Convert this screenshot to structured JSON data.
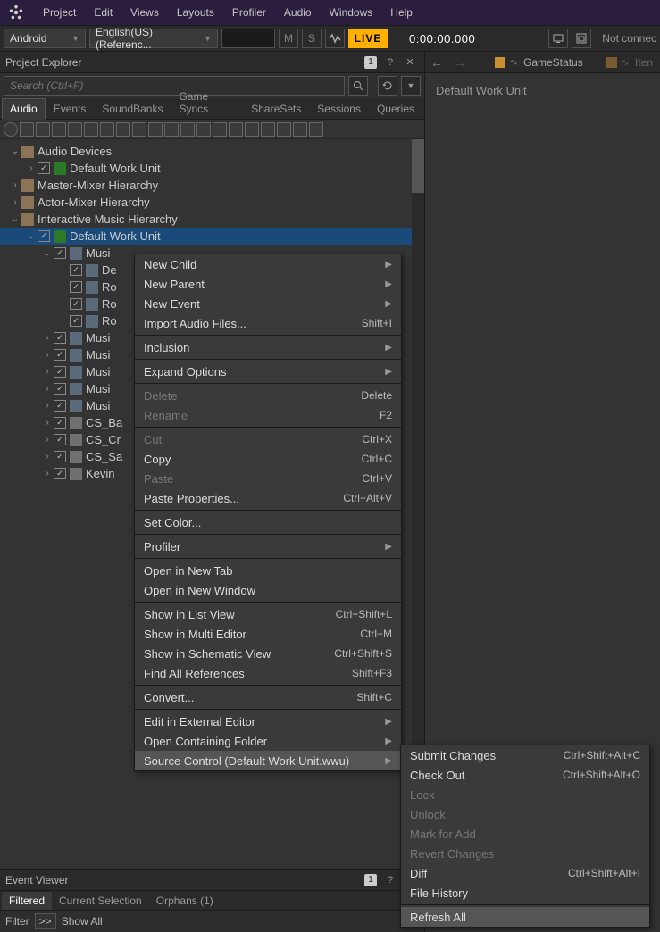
{
  "menubar": {
    "items": [
      "Project",
      "Edit",
      "Views",
      "Layouts",
      "Profiler",
      "Audio",
      "Windows",
      "Help"
    ]
  },
  "toolbar": {
    "platform": "Android",
    "language": "English(US) (Referenc...",
    "m_label": "M",
    "s_label": "S",
    "live_label": "LIVE",
    "time": "0:00:00.000",
    "not_connected": "Not connec"
  },
  "project_explorer": {
    "title": "Project Explorer",
    "badge": "1",
    "search_placeholder": "Search (Ctrl+F)",
    "tabs": [
      "Audio",
      "Events",
      "SoundBanks",
      "Game Syncs",
      "ShareSets",
      "Sessions",
      "Queries"
    ],
    "active_tab": 0,
    "tree": [
      {
        "indent": 0,
        "exp": "down",
        "chk": false,
        "icon": "folder",
        "label": "Audio Devices"
      },
      {
        "indent": 1,
        "exp": "right",
        "chk": true,
        "icon": "wunit",
        "label": "Default Work Unit"
      },
      {
        "indent": 0,
        "exp": "right",
        "chk": false,
        "icon": "folder",
        "label": "Master-Mixer Hierarchy"
      },
      {
        "indent": 0,
        "exp": "right",
        "chk": false,
        "icon": "folder",
        "label": "Actor-Mixer Hierarchy"
      },
      {
        "indent": 0,
        "exp": "down",
        "chk": false,
        "icon": "folder",
        "label": "Interactive Music Hierarchy"
      },
      {
        "indent": 1,
        "exp": "down",
        "chk": true,
        "icon": "wunit",
        "label": "Default Work Unit",
        "selected": true
      },
      {
        "indent": 2,
        "exp": "down",
        "chk": true,
        "icon": "musics",
        "label": "Musi"
      },
      {
        "indent": 3,
        "exp": "none",
        "chk": true,
        "icon": "musics",
        "label": "De"
      },
      {
        "indent": 3,
        "exp": "none",
        "chk": true,
        "icon": "musics",
        "label": "Ro"
      },
      {
        "indent": 3,
        "exp": "none",
        "chk": true,
        "icon": "musics",
        "label": "Ro"
      },
      {
        "indent": 3,
        "exp": "none",
        "chk": true,
        "icon": "musics",
        "label": "Ro"
      },
      {
        "indent": 2,
        "exp": "right",
        "chk": true,
        "icon": "musics",
        "label": "Musi"
      },
      {
        "indent": 2,
        "exp": "right",
        "chk": true,
        "icon": "musics",
        "label": "Musi"
      },
      {
        "indent": 2,
        "exp": "right",
        "chk": true,
        "icon": "musics",
        "label": "Musi"
      },
      {
        "indent": 2,
        "exp": "right",
        "chk": true,
        "icon": "musics",
        "label": "Musi"
      },
      {
        "indent": 2,
        "exp": "right",
        "chk": true,
        "icon": "musics",
        "label": "Musi"
      },
      {
        "indent": 2,
        "exp": "right",
        "chk": true,
        "icon": "csicon",
        "label": "CS_Ba"
      },
      {
        "indent": 2,
        "exp": "right",
        "chk": true,
        "icon": "csicon",
        "label": "CS_Cr"
      },
      {
        "indent": 2,
        "exp": "right",
        "chk": true,
        "icon": "csicon",
        "label": "CS_Sa"
      },
      {
        "indent": 2,
        "exp": "right",
        "chk": true,
        "icon": "csicon",
        "label": "Kevin"
      }
    ]
  },
  "event_viewer": {
    "title": "Event Viewer",
    "badge": "1",
    "tabs": [
      "Filtered",
      "Current Selection",
      "Orphans (1)"
    ],
    "active_tab": 0,
    "filter_label": "Filter",
    "fwd_label": ">>",
    "showall_label": "Show All"
  },
  "right_panel": {
    "tabs": [
      {
        "label": "GameStatus",
        "dim": false
      },
      {
        "label": "Iten",
        "dim": true
      }
    ],
    "body_text": "Default Work Unit"
  },
  "ctx_main": {
    "items": [
      {
        "label": "New Child",
        "sub": true
      },
      {
        "label": "New Parent",
        "sub": true
      },
      {
        "label": "New Event",
        "sub": true
      },
      {
        "label": "Import Audio Files...",
        "shortcut": "Shift+I"
      },
      {
        "sep": true
      },
      {
        "label": "Inclusion",
        "sub": true
      },
      {
        "sep": true
      },
      {
        "label": "Expand Options",
        "sub": true
      },
      {
        "sep": true
      },
      {
        "label": "Delete",
        "shortcut": "Delete",
        "disabled": true
      },
      {
        "label": "Rename",
        "shortcut": "F2",
        "disabled": true
      },
      {
        "sep": true
      },
      {
        "label": "Cut",
        "shortcut": "Ctrl+X",
        "disabled": true
      },
      {
        "label": "Copy",
        "shortcut": "Ctrl+C"
      },
      {
        "label": "Paste",
        "shortcut": "Ctrl+V",
        "disabled": true
      },
      {
        "label": "Paste Properties...",
        "shortcut": "Ctrl+Alt+V"
      },
      {
        "sep": true
      },
      {
        "label": "Set Color..."
      },
      {
        "sep": true
      },
      {
        "label": "Profiler",
        "sub": true
      },
      {
        "sep": true
      },
      {
        "label": "Open in New Tab"
      },
      {
        "label": "Open in New Window"
      },
      {
        "sep": true
      },
      {
        "label": "Show in List View",
        "shortcut": "Ctrl+Shift+L"
      },
      {
        "label": "Show in Multi Editor",
        "shortcut": "Ctrl+M"
      },
      {
        "label": "Show in Schematic View",
        "shortcut": "Ctrl+Shift+S"
      },
      {
        "label": "Find All References",
        "shortcut": "Shift+F3"
      },
      {
        "sep": true
      },
      {
        "label": "Convert...",
        "shortcut": "Shift+C"
      },
      {
        "sep": true
      },
      {
        "label": "Edit in External Editor",
        "sub": true
      },
      {
        "label": "Open Containing Folder",
        "sub": true
      },
      {
        "label": "Source Control (Default Work Unit.wwu)",
        "sub": true,
        "highlighted": true
      }
    ]
  },
  "ctx_sub": {
    "items": [
      {
        "label": "Submit Changes",
        "shortcut": "Ctrl+Shift+Alt+C"
      },
      {
        "label": "Check Out",
        "shortcut": "Ctrl+Shift+Alt+O"
      },
      {
        "label": "Lock",
        "disabled": true
      },
      {
        "label": "Unlock",
        "disabled": true
      },
      {
        "label": "Mark for Add",
        "disabled": true
      },
      {
        "label": "Revert Changes",
        "disabled": true
      },
      {
        "label": "Diff",
        "shortcut": "Ctrl+Shift+Alt+I"
      },
      {
        "label": "File History"
      },
      {
        "sep": true
      },
      {
        "label": "Refresh All",
        "highlighted": true
      }
    ]
  }
}
